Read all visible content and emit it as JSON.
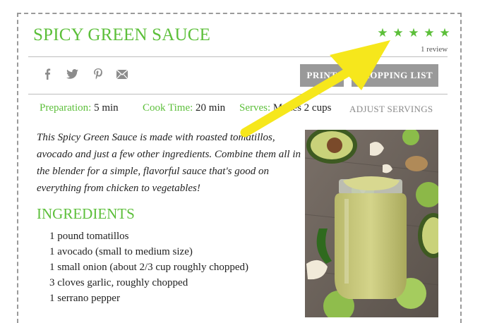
{
  "recipe": {
    "title": "SPICY GREEN SAUCE",
    "rating_stars": 5,
    "review_count": "1 review",
    "description": "This Spicy Green Sauce is made with roasted tomatillos, avocado and just a few other ingredients. Combine them all in the blender for a simple, flavorful sauce that's good on everything from chicken to vegetables!"
  },
  "share": {
    "icons": [
      "facebook-icon",
      "twitter-icon",
      "pinterest-icon",
      "email-icon"
    ]
  },
  "actions": {
    "print_label": "PRINT",
    "shopping_list_label": "SHOPPING LIST"
  },
  "meta": {
    "prep_label": "Preparation:",
    "prep_value": "5 min",
    "cook_label": "Cook Time:",
    "cook_value": "20 min",
    "serves_label": "Serves:",
    "serves_value": "Makes 2 cups",
    "adjust_label": "ADJUST SERVINGS"
  },
  "ingredients": {
    "title": "INGREDIENTS",
    "items": [
      "1 pound tomatillos",
      "1 avocado (small to medium size)",
      "1 small onion (about 2/3 cup roughly chopped)",
      "3 cloves garlic, roughly chopped",
      "1 serrano pepper"
    ]
  },
  "colors": {
    "accent_green": "#5cbf3a",
    "button_gray": "#999999",
    "arrow_yellow": "#f6e71c"
  }
}
